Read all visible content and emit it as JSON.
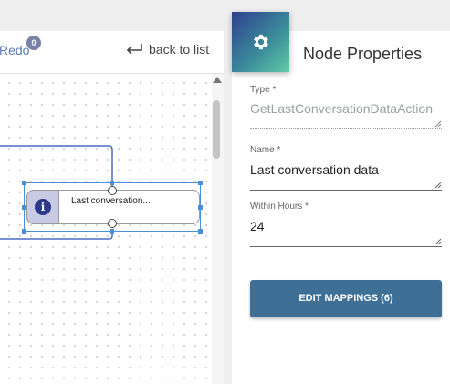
{
  "toolbar": {
    "redo_label": "Redo",
    "redo_count": "0",
    "back_label": "back to list"
  },
  "node": {
    "label": "Last conversation...",
    "icon": "info-icon"
  },
  "properties": {
    "title": "Node Properties",
    "icon": "gear-icon",
    "fields": [
      {
        "label": "Type *",
        "value": "GetLastConversationDataAction",
        "disabled": true
      },
      {
        "label": "Name *",
        "value": "Last conversation data",
        "disabled": false
      },
      {
        "label": "Within Hours *",
        "value": "24",
        "disabled": false
      }
    ],
    "edit_mappings_label": "EDIT MAPPINGS (6)"
  },
  "colors": {
    "accent_button": "#3e6f96",
    "selection": "#4a90d9",
    "link": "#5b7bb5"
  }
}
